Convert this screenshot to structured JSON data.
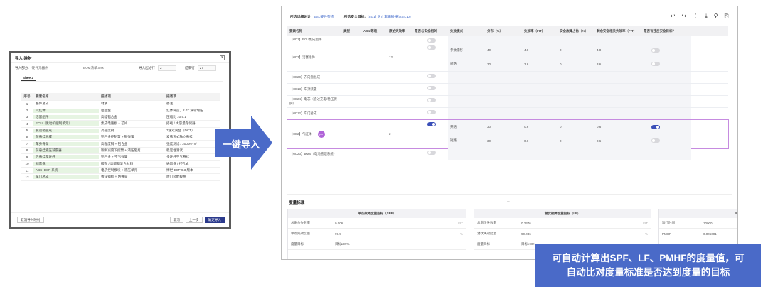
{
  "left_dialog": {
    "title": "导入-映射",
    "import_part_label": "导入部分:",
    "import_part_value": "硬件元器件",
    "file_name": "BOM清单.xlsx",
    "start_row_label": "导入起始行",
    "start_row_value": "2",
    "end_row_label": "结束行",
    "end_row_value": "27",
    "sheet_tab": "Sheet1",
    "columns": [
      "序号",
      "要素名称",
      "描述项",
      "描述项"
    ],
    "rows": [
      [
        "1",
        "整件总成",
        "材质",
        "备注"
      ],
      [
        "2",
        "气缸体",
        "铝合金",
        "缸体铸造，2.0T 涡轮增压"
      ],
      [
        "3",
        "活塞组件",
        "高硅铝合金",
        "压缩比 10.5:1"
      ],
      [
        "4",
        "ECU（发动机控制单元）",
        "集成电路板 + 芯片",
        "搭载 / 大容量存储器"
      ],
      [
        "5",
        "变速箱总成",
        "高强度钢",
        "7速双离合（DCT）"
      ],
      [
        "6",
        "前悬挂总成",
        "铝合金控制臂 + 钢弹簧",
        "麦弗逊式独立悬挂"
      ],
      [
        "7",
        "车身骨架",
        "高强度钢 + 铝合金",
        "强度测试 / 2000N·m²"
      ],
      [
        "8",
        "前悬挂液压减震器",
        "钢制减震下摆臂 + 液压阻尼",
        "稳定性测试"
      ],
      [
        "9",
        "后悬挂多连杆",
        "铝合金 + 空气弹簧",
        "多连杆空气悬挂"
      ],
      [
        "10",
        "刹车盘",
        "碳陶 / 高碳钢复合材料",
        "通风盘 / 打孔式"
      ],
      [
        "11",
        "ABS+ESP 系统",
        "电子控制模块 + 液压单元",
        "博世 ESP 9.3 版本"
      ],
      [
        "12",
        "车门总成",
        "镀锌钢板 + 防撞梁",
        "防门装配规格"
      ]
    ],
    "cancel_mapping_label": "取消导入映射",
    "cancel_label": "取消",
    "prev_label": "上一步",
    "confirm_label": "确定导入"
  },
  "arrow_label": "一键导入",
  "right_window": {
    "analysis_label": "所选详细设计:",
    "analysis_value": "ESL硬件架构",
    "target_label": "所选安全目标:",
    "target_value": "[SG1] 防止车辆碰撞(ASIL D)",
    "tool_icons": [
      "undo-icon",
      "redo-icon",
      "more-icon",
      "download-icon",
      "search-icon",
      "attach-icon"
    ],
    "columns": [
      "要素名称",
      "类型",
      "ASIL等级",
      "原始失效率",
      "是否与安全相关",
      "失效模式",
      "分布（%）",
      "失效率（FIT）",
      "安全故障占比（%）",
      "剩余安全相关失效率（FIT）",
      "是否有违反安全目标？"
    ],
    "rows": [
      {
        "name": "【HC1】ECU集成组件",
        "rate": "",
        "toggle": false,
        "sub": []
      },
      {
        "name": "【HC3】活塞组件",
        "rate": "12",
        "toggle": false,
        "sub": [
          {
            "mode": "参数漂移",
            "dist": "40",
            "fit": "4.8",
            "sf": "0",
            "residual": "4.8"
          },
          {
            "mode": "短路",
            "dist": "30",
            "fit": "3.6",
            "sf": "0",
            "residual": "3.6"
          }
        ]
      },
      {
        "name": "【HC20】方向盘总成",
        "rate": "",
        "toggle": false,
        "sub": []
      },
      {
        "name": "【HC13】车顶装置",
        "rate": "",
        "toggle": false,
        "sub": []
      },
      {
        "name": "【HC24】电芯（含过充电/稳压保护）",
        "rate": "",
        "toggle": false,
        "sub": []
      },
      {
        "name": "【HC12】车门总成",
        "rate": "",
        "toggle": false,
        "sub": []
      },
      {
        "name": "【HC2】气缸体",
        "badge": "pro",
        "rate": "2",
        "toggle": true,
        "sub": [
          {
            "mode": "开路",
            "dist": "30",
            "fit": "0.6",
            "sf": "0",
            "residual": "0.6"
          },
          {
            "mode": "短路",
            "dist": "30",
            "fit": "0.6",
            "sf": "0",
            "residual": "0.6"
          }
        ]
      },
      {
        "name": "【HC23】BMS（电池管理系统）",
        "rate": "",
        "toggle": false,
        "sub": []
      }
    ],
    "metrics_title": "度量标准",
    "spf": {
      "title": "单点故障度量指标（SPF）",
      "rows": [
        {
          "k": "总剩余失效率",
          "v": "0.006",
          "u": "FIT"
        },
        {
          "k": "单点失效度量",
          "v": "99.9",
          "u": "%"
        },
        {
          "k": "度量目标",
          "v": "目标≥99%",
          "u": ""
        }
      ]
    },
    "lf": {
      "title": "潜伏故障度量指标（LF）",
      "rows": [
        {
          "k": "总潜伏失效率",
          "v": "0.2376",
          "u": "FIT"
        },
        {
          "k": "潜伏失效度量",
          "v": "90.036",
          "u": "%"
        },
        {
          "k": "度量目标",
          "v": "目标≥90%",
          "u": ""
        }
      ]
    },
    "pmhf": {
      "header": "P",
      "rows": [
        {
          "k": "运行时间",
          "v": "10000"
        },
        {
          "k": "PMHF",
          "v": "0.006601"
        }
      ]
    }
  },
  "callout_line1": "可自动计算出SPF、LF、PMHF的度量值，可",
  "callout_line2": "自动比对度量标准是否达到度量的目标"
}
